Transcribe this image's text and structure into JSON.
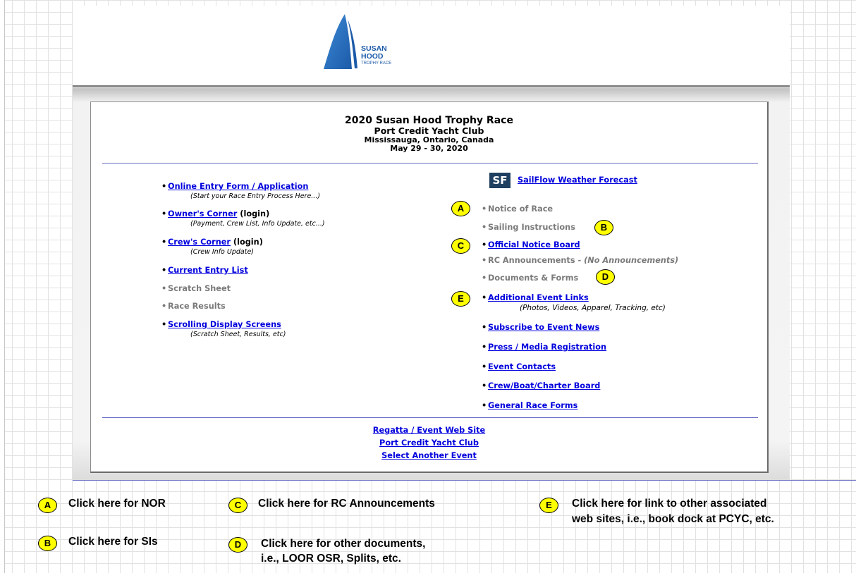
{
  "logo": {
    "line1": "SUSAN",
    "line2": "HOOD",
    "line3": "TROPHY RACE"
  },
  "event": {
    "title": "2020 Susan Hood Trophy Race",
    "club": "Port Credit Yacht Club",
    "location": "Mississauga, Ontario, Canada",
    "dates": "May 29 - 30, 2020"
  },
  "left_menu": {
    "entry_form": {
      "label": "Online Entry Form / Application",
      "note": "(Start your Race Entry Process Here...)"
    },
    "owners_corner": {
      "label": "Owner's Corner",
      "suffix": "(login)",
      "note": "(Payment, Crew List, Info Update, etc...)"
    },
    "crews_corner": {
      "label": "Crew's Corner",
      "suffix": "(login)",
      "note": "(Crew Info Update)"
    },
    "entry_list": {
      "label": "Current Entry List"
    },
    "scratch_sheet": {
      "label": "Scratch Sheet"
    },
    "race_results": {
      "label": "Race Results"
    },
    "scrolling": {
      "label": "Scrolling Display Screens",
      "note": "(Scratch Sheet, Results, etc)"
    }
  },
  "right_menu": {
    "sf_badge": "SF",
    "weather": {
      "label": "SailFlow Weather Forecast"
    },
    "nor": {
      "label": "Notice of Race"
    },
    "sailing_instructions": {
      "label": "Sailing Instructions"
    },
    "notice_board": {
      "label": "Official Notice Board"
    },
    "rc_announcements": {
      "label": "RC Announcements - ",
      "note": "(No Announcements)"
    },
    "documents": {
      "label": "Documents & Forms"
    },
    "event_links": {
      "label": "Additional Event Links",
      "note": "(Photos, Videos, Apparel, Tracking, etc)"
    },
    "subscribe": {
      "label": "Subscribe to Event News"
    },
    "press": {
      "label": "Press / Media Registration"
    },
    "contacts": {
      "label": "Event Contacts"
    },
    "crew_board": {
      "label": "Crew/Boat/Charter Board"
    },
    "race_forms": {
      "label": "General Race Forms"
    }
  },
  "footer_links": {
    "regatta_site": "Regatta / Event Web Site",
    "club_site": "Port Credit Yacht Club",
    "select_event": "Select Another Event"
  },
  "markers": {
    "a": "A",
    "b": "B",
    "c": "C",
    "d": "D",
    "e": "E"
  },
  "legend": {
    "a": "Click here for NOR",
    "b": "Click here for SIs",
    "c": "Click here for RC Announcements",
    "d_line1": "Click here for other documents,",
    "d_line2": "i.e., LOOR OSR, Splits, etc.",
    "e_line1": "Click here for link to other associated",
    "e_line2": "web sites, i.e., book dock at PCYC, etc."
  },
  "colors": {
    "link": "#0000dd",
    "disabled": "#7a7a7a",
    "rule": "#6a6fc6",
    "marker": "#ffff00",
    "sf_badge": "#1f3f61"
  }
}
